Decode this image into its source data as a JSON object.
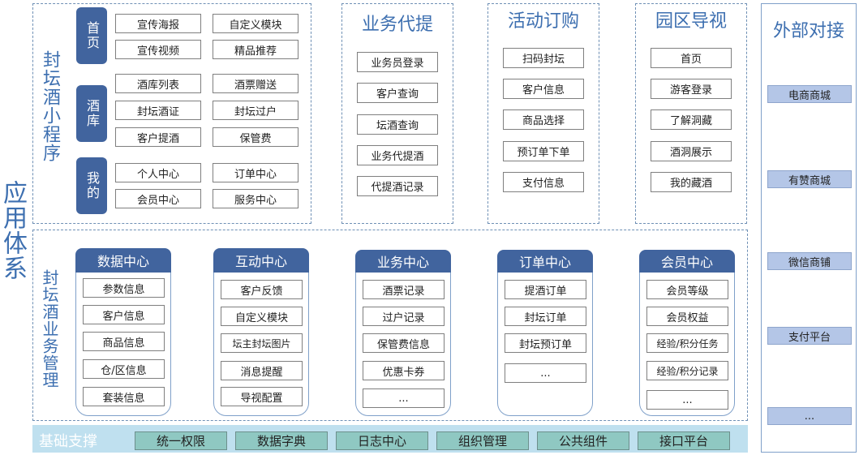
{
  "app_system_title": "应用体系",
  "miniprogram": {
    "title": "封坛酒小程序",
    "groups": [
      {
        "tab": "首页",
        "items": [
          "宣传海报",
          "自定义模块",
          "宣传视频",
          "精品推荐"
        ]
      },
      {
        "tab": "酒库",
        "items": [
          "酒库列表",
          "酒票赠送",
          "封坛酒证",
          "封坛过户",
          "客户提酒",
          "保管费"
        ]
      },
      {
        "tab": "我的",
        "items": [
          "个人中心",
          "订单中心",
          "会员中心",
          "服务中心"
        ]
      }
    ]
  },
  "columns": [
    {
      "title": "业务代提",
      "items": [
        "业务员登录",
        "客户查询",
        "坛酒查询",
        "业务代提酒",
        "代提酒记录"
      ]
    },
    {
      "title": "活动订购",
      "items": [
        "扫码封坛",
        "客户信息",
        "商品选择",
        "预订单下单",
        "支付信息"
      ]
    },
    {
      "title": "园区导视",
      "items": [
        "首页",
        "游客登录",
        "了解洞藏",
        "酒洞展示",
        "我的藏酒"
      ]
    }
  ],
  "external": {
    "title": "外部对接",
    "items": [
      "电商商城",
      "有赞商城",
      "微信商铺",
      "支付平台",
      "..."
    ]
  },
  "management": {
    "title": "封坛酒业务管理",
    "centers": [
      {
        "title": "数据中心",
        "items": [
          "参数信息",
          "客户信息",
          "商品信息",
          "仓/区信息",
          "套装信息"
        ]
      },
      {
        "title": "互动中心",
        "items": [
          "客户反馈",
          "自定义模块",
          "坛主封坛图片",
          "消息提醒",
          "导视配置"
        ]
      },
      {
        "title": "业务中心",
        "items": [
          "酒票记录",
          "过户记录",
          "保管费信息",
          "优惠卡券",
          "..."
        ]
      },
      {
        "title": "订单中心",
        "items": [
          "提酒订单",
          "封坛订单",
          "封坛预订单",
          "..."
        ]
      },
      {
        "title": "会员中心",
        "items": [
          "会员等级",
          "会员权益",
          "经验/积分任务",
          "经验/积分记录",
          "..."
        ]
      }
    ]
  },
  "base": {
    "title": "基础支撑",
    "items": [
      "统一权限",
      "数据字典",
      "日志中心",
      "组织管理",
      "公共组件",
      "接口平台"
    ]
  }
}
